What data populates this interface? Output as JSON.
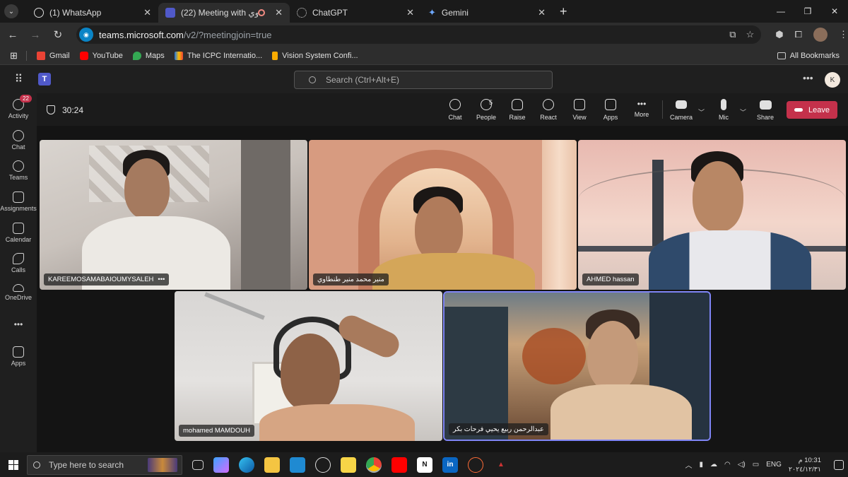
{
  "browser": {
    "tabs": [
      {
        "title": "(1) WhatsApp",
        "icon": "whatsapp-icon"
      },
      {
        "title": "(22) Meeting with طنطاوي",
        "icon": "teams-icon",
        "active": true
      },
      {
        "title": "ChatGPT",
        "icon": "chatgpt-icon"
      },
      {
        "title": "Gemini",
        "icon": "gemini-icon"
      }
    ],
    "url_host": "teams.microsoft.com",
    "url_path": "/v2/?meetingjoin=true",
    "bookmarks": [
      {
        "label": "Gmail",
        "color": "#ea4335"
      },
      {
        "label": "YouTube",
        "color": "#ff0000"
      },
      {
        "label": "Maps",
        "color": "#34a853"
      },
      {
        "label": "The ICPC Internatio...",
        "color": "#1a73e8"
      },
      {
        "label": "Vision System Confi...",
        "color": "#f9ab00"
      }
    ],
    "all_bookmarks": "All Bookmarks"
  },
  "teams": {
    "search_placeholder": "Search (Ctrl+Alt+E)",
    "user_initial": "K",
    "rail": [
      {
        "label": "Activity",
        "badge": "22"
      },
      {
        "label": "Chat"
      },
      {
        "label": "Teams"
      },
      {
        "label": "Assignments"
      },
      {
        "label": "Calendar"
      },
      {
        "label": "Calls"
      },
      {
        "label": "OneDrive"
      },
      {
        "label": "Apps"
      }
    ],
    "more_dots": "•••"
  },
  "meeting": {
    "timer": "30:24",
    "people_count": "5",
    "controls": {
      "chat": "Chat",
      "people": "People",
      "raise": "Raise",
      "react": "React",
      "view": "View",
      "apps": "Apps",
      "more": "More",
      "camera": "Camera",
      "mic": "Mic",
      "share": "Share",
      "leave": "Leave"
    },
    "participants": [
      {
        "name": "KAREEMOSAMABAIOUMYSALEH",
        "more": "•••"
      },
      {
        "name": "منير محمد منير طنطاوي"
      },
      {
        "name": "AHMED hassan"
      },
      {
        "name": "mohamed MAMDOUH"
      },
      {
        "name": "عبدالرحمن ربيع يحيي فرحات بكر"
      }
    ]
  },
  "taskbar": {
    "search_placeholder": "Type here to search",
    "language": "ENG",
    "time": "10:31 م",
    "date": "٢٠٢٤/١٢/٣١"
  },
  "colors": {
    "leave": "#c4314b",
    "active_speaker": "#7f85f5",
    "teams_brand": "#5059c9"
  }
}
